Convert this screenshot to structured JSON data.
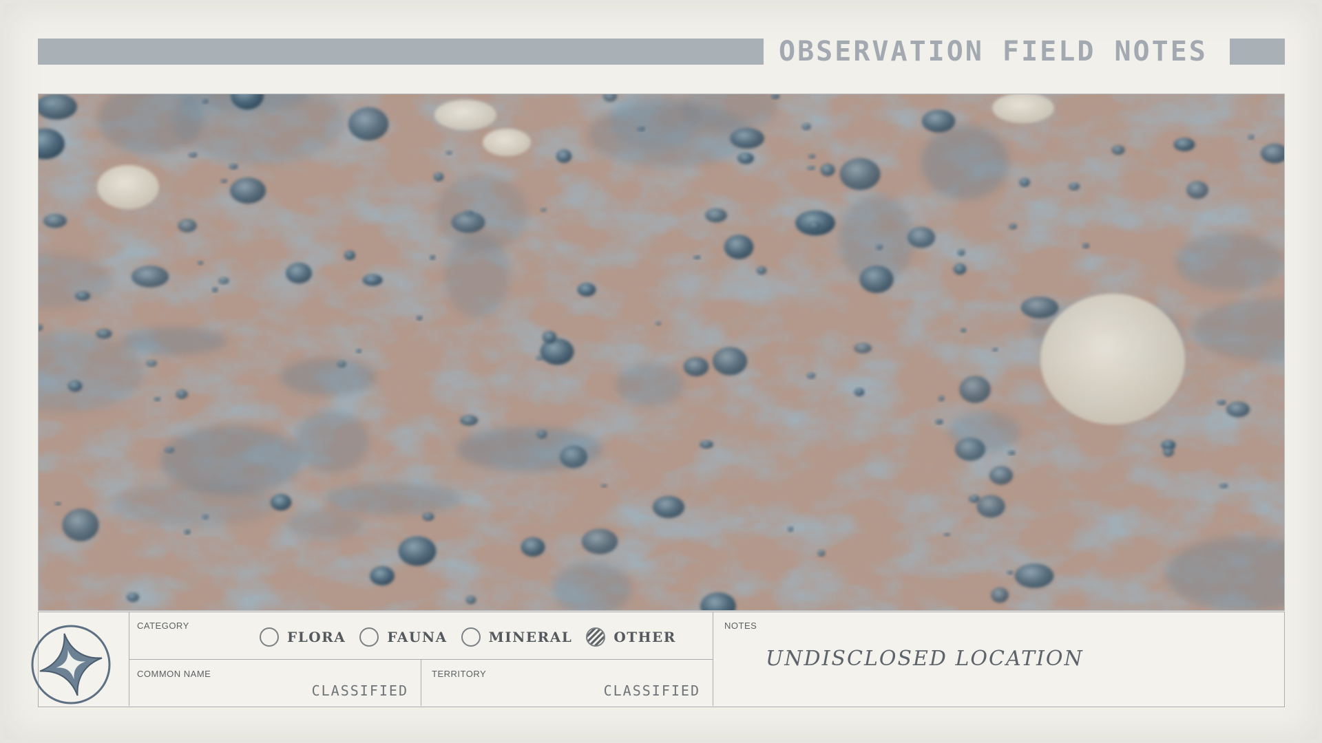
{
  "header": {
    "title": "OBSERVATION FIELD NOTES"
  },
  "photo": {
    "icon": "terrain-photo",
    "colors": {
      "soil": "#b3978a",
      "shadow": "#5a7588",
      "stone": "#d9d4c8"
    }
  },
  "form": {
    "emblem_icon": "four-point-star-emblem-icon",
    "category": {
      "label": "CATEGORY",
      "options": [
        {
          "label": "FLORA",
          "selected": false
        },
        {
          "label": "FAUNA",
          "selected": false
        },
        {
          "label": "MINERAL",
          "selected": false
        },
        {
          "label": "OTHER",
          "selected": true
        }
      ]
    },
    "common_name": {
      "label": "COMMON NAME",
      "value": "CLASSIFIED"
    },
    "territory": {
      "label": "TERRITORY",
      "value": "CLASSIFIED"
    },
    "notes": {
      "label": "NOTES",
      "value": "UNDISCLOSED LOCATION"
    }
  },
  "colors": {
    "paper": "#f1f0ea",
    "bar": "#a9b0b6",
    "ink": "#54595d"
  }
}
